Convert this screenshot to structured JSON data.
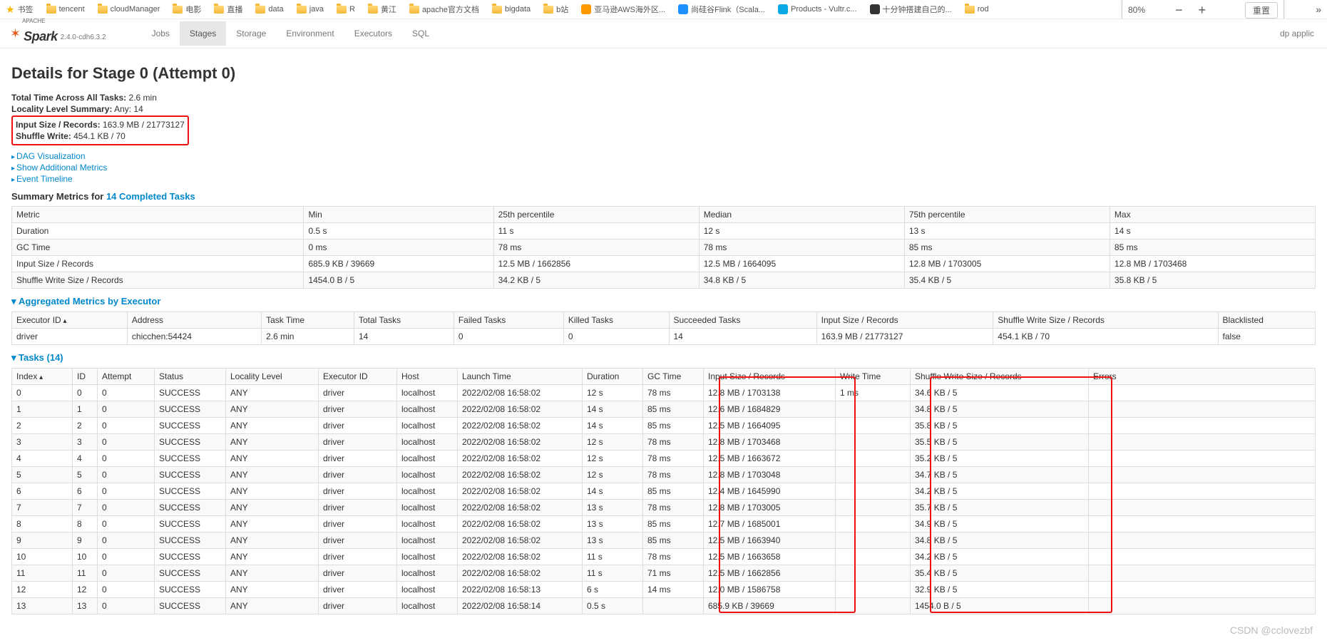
{
  "bookmarks": {
    "items": [
      {
        "kind": "star",
        "label": "书签"
      },
      {
        "kind": "folder",
        "label": "tencent"
      },
      {
        "kind": "folder",
        "label": "cloudManager"
      },
      {
        "kind": "folder",
        "label": "电影"
      },
      {
        "kind": "folder",
        "label": "直播"
      },
      {
        "kind": "folder",
        "label": "data"
      },
      {
        "kind": "folder",
        "label": "java"
      },
      {
        "kind": "folder",
        "label": "R"
      },
      {
        "kind": "folder",
        "label": "黄江"
      },
      {
        "kind": "folder",
        "label": "apache官方文档"
      },
      {
        "kind": "folder",
        "label": "bigdata"
      },
      {
        "kind": "folder",
        "label": "b站"
      },
      {
        "kind": "icon",
        "color": "#ff9900",
        "label": "亚马逊AWS海外区..."
      },
      {
        "kind": "icon",
        "color": "#1e90ff",
        "label": "尚硅谷Flink（Scala..."
      },
      {
        "kind": "icon",
        "color": "#0aa8e6",
        "label": "Products - Vultr.c..."
      },
      {
        "kind": "icon",
        "color": "#333",
        "label": "十分钟搭建自己的..."
      },
      {
        "kind": "folder",
        "label": "rod"
      }
    ],
    "overflow": "»"
  },
  "zoom": {
    "pct": "80%",
    "minus": "−",
    "plus": "+",
    "reset": "重置"
  },
  "header": {
    "logo_small": "APACHE",
    "logo_name": "Spark",
    "version": "2.4.0-cdh6.3.2",
    "nav": [
      "Jobs",
      "Stages",
      "Storage",
      "Environment",
      "Executors",
      "SQL"
    ],
    "active": "Stages",
    "right": "dp applic"
  },
  "page": {
    "title": "Details for Stage 0 (Attempt 0)",
    "kv": [
      {
        "k": "Total Time Across All Tasks:",
        "v": "2.6 min"
      },
      {
        "k": "Locality Level Summary:",
        "v": "Any: 14"
      },
      {
        "k": "Input Size / Records:",
        "v": "163.9 MB / 21773127"
      },
      {
        "k": "Shuffle Write:",
        "v": "454.1 KB / 70"
      }
    ],
    "links": [
      "DAG Visualization",
      "Show Additional Metrics",
      "Event Timeline"
    ],
    "summary_title_prefix": "Summary Metrics for ",
    "summary_title_link": "14 Completed Tasks",
    "agg_title": "Aggregated Metrics by Executor",
    "tasks_title": "Tasks (14)"
  },
  "summary": {
    "headers": [
      "Metric",
      "Min",
      "25th percentile",
      "Median",
      "75th percentile",
      "Max"
    ],
    "rows": [
      [
        "Duration",
        "0.5 s",
        "11 s",
        "12 s",
        "13 s",
        "14 s"
      ],
      [
        "GC Time",
        "0 ms",
        "78 ms",
        "78 ms",
        "85 ms",
        "85 ms"
      ],
      [
        "Input Size / Records",
        "685.9 KB / 39669",
        "12.5 MB / 1662856",
        "12.5 MB / 1664095",
        "12.8 MB / 1703005",
        "12.8 MB / 1703468"
      ],
      [
        "Shuffle Write Size / Records",
        "1454.0 B / 5",
        "34.2 KB / 5",
        "34.8 KB / 5",
        "35.4 KB / 5",
        "35.8 KB / 5"
      ]
    ]
  },
  "agg": {
    "headers": [
      "Executor ID",
      "Address",
      "Task Time",
      "Total Tasks",
      "Failed Tasks",
      "Killed Tasks",
      "Succeeded Tasks",
      "Input Size / Records",
      "Shuffle Write Size / Records",
      "Blacklisted"
    ],
    "rows": [
      [
        "driver",
        "chicchen:54424",
        "2.6 min",
        "14",
        "0",
        "0",
        "14",
        "163.9 MB / 21773127",
        "454.1 KB / 70",
        "false"
      ]
    ]
  },
  "tasks": {
    "headers": [
      "Index",
      "ID",
      "Attempt",
      "Status",
      "Locality Level",
      "Executor ID",
      "Host",
      "Launch Time",
      "Duration",
      "GC Time",
      "Input Size / Records",
      "Write Time",
      "Shuffle Write Size / Records",
      "Errors"
    ],
    "rows": [
      [
        "0",
        "0",
        "0",
        "SUCCESS",
        "ANY",
        "driver",
        "localhost",
        "2022/02/08 16:58:02",
        "12 s",
        "78 ms",
        "12.8 MB / 1703138",
        "1 ms",
        "34.6 KB / 5",
        ""
      ],
      [
        "1",
        "1",
        "0",
        "SUCCESS",
        "ANY",
        "driver",
        "localhost",
        "2022/02/08 16:58:02",
        "14 s",
        "85 ms",
        "12.6 MB / 1684829",
        "",
        "34.8 KB / 5",
        ""
      ],
      [
        "2",
        "2",
        "0",
        "SUCCESS",
        "ANY",
        "driver",
        "localhost",
        "2022/02/08 16:58:02",
        "14 s",
        "85 ms",
        "12.5 MB / 1664095",
        "",
        "35.8 KB / 5",
        ""
      ],
      [
        "3",
        "3",
        "0",
        "SUCCESS",
        "ANY",
        "driver",
        "localhost",
        "2022/02/08 16:58:02",
        "12 s",
        "78 ms",
        "12.8 MB / 1703468",
        "",
        "35.5 KB / 5",
        ""
      ],
      [
        "4",
        "4",
        "0",
        "SUCCESS",
        "ANY",
        "driver",
        "localhost",
        "2022/02/08 16:58:02",
        "12 s",
        "78 ms",
        "12.5 MB / 1663672",
        "",
        "35.2 KB / 5",
        ""
      ],
      [
        "5",
        "5",
        "0",
        "SUCCESS",
        "ANY",
        "driver",
        "localhost",
        "2022/02/08 16:58:02",
        "12 s",
        "78 ms",
        "12.8 MB / 1703048",
        "",
        "34.7 KB / 5",
        ""
      ],
      [
        "6",
        "6",
        "0",
        "SUCCESS",
        "ANY",
        "driver",
        "localhost",
        "2022/02/08 16:58:02",
        "14 s",
        "85 ms",
        "12.4 MB / 1645990",
        "",
        "34.2 KB / 5",
        ""
      ],
      [
        "7",
        "7",
        "0",
        "SUCCESS",
        "ANY",
        "driver",
        "localhost",
        "2022/02/08 16:58:02",
        "13 s",
        "78 ms",
        "12.8 MB / 1703005",
        "",
        "35.7 KB / 5",
        ""
      ],
      [
        "8",
        "8",
        "0",
        "SUCCESS",
        "ANY",
        "driver",
        "localhost",
        "2022/02/08 16:58:02",
        "13 s",
        "85 ms",
        "12.7 MB / 1685001",
        "",
        "34.9 KB / 5",
        ""
      ],
      [
        "9",
        "9",
        "0",
        "SUCCESS",
        "ANY",
        "driver",
        "localhost",
        "2022/02/08 16:58:02",
        "13 s",
        "85 ms",
        "12.5 MB / 1663940",
        "",
        "34.8 KB / 5",
        ""
      ],
      [
        "10",
        "10",
        "0",
        "SUCCESS",
        "ANY",
        "driver",
        "localhost",
        "2022/02/08 16:58:02",
        "11 s",
        "78 ms",
        "12.5 MB / 1663658",
        "",
        "34.2 KB / 5",
        ""
      ],
      [
        "11",
        "11",
        "0",
        "SUCCESS",
        "ANY",
        "driver",
        "localhost",
        "2022/02/08 16:58:02",
        "11 s",
        "71 ms",
        "12.5 MB / 1662856",
        "",
        "35.4 KB / 5",
        ""
      ],
      [
        "12",
        "12",
        "0",
        "SUCCESS",
        "ANY",
        "driver",
        "localhost",
        "2022/02/08 16:58:13",
        "6 s",
        "14 ms",
        "12.0 MB / 1586758",
        "",
        "32.9 KB / 5",
        ""
      ],
      [
        "13",
        "13",
        "0",
        "SUCCESS",
        "ANY",
        "driver",
        "localhost",
        "2022/02/08 16:58:14",
        "0.5 s",
        "",
        "685.9 KB / 39669",
        "",
        "1454.0 B / 5",
        ""
      ]
    ]
  },
  "watermark": "CSDN @cclovezbf"
}
